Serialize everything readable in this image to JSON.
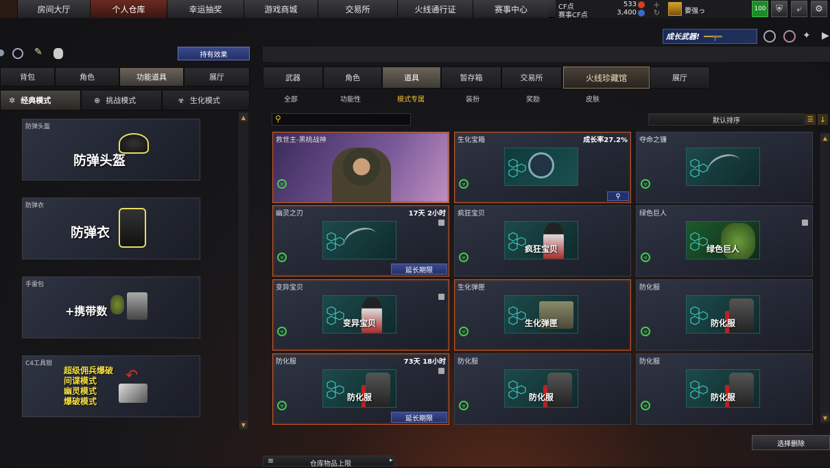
{
  "nav": {
    "tabs": [
      "房间大厅",
      "个人仓库",
      "幸运抽奖",
      "游戏商城",
      "交易所",
      "火线通行证",
      "赛事中心"
    ],
    "active_index": 1
  },
  "currency": {
    "cf_label": "CF点",
    "cf_value": "533",
    "match_cf_label": "赛事CF点",
    "match_cf_value": "3,400"
  },
  "user": {
    "name": "要强っ",
    "level": "100"
  },
  "promo": {
    "text": "成长武器!"
  },
  "left": {
    "effect_button": "持有效果",
    "tabs": [
      "背包",
      "角色",
      "功能道具",
      "展厅"
    ],
    "selected_tab": 2,
    "modes": [
      "经典模式",
      "挑战模式",
      "生化模式"
    ],
    "selected_mode": 0,
    "cards": [
      {
        "title": "防弹头盔",
        "big": "防弹头盔"
      },
      {
        "title": "防弹衣",
        "big": "防弹衣"
      },
      {
        "title": "手雷包",
        "big": "+携带数"
      },
      {
        "title": "C4工具钳",
        "lines": [
          "超级佣兵爆破",
          "间谍模式",
          "幽灵模式",
          "爆破模式"
        ]
      }
    ]
  },
  "right": {
    "tabs": [
      "武器",
      "角色",
      "道具",
      "暂存箱",
      "交易所",
      "火线珍藏馆",
      "展厅"
    ],
    "selected_tab": 2,
    "subtabs": [
      "全部",
      "功能性",
      "模式专属",
      "装扮",
      "奖励",
      "皮肤"
    ],
    "selected_subtab": 2,
    "search_placeholder": "",
    "sort_label": "默认排序",
    "items": [
      {
        "name": "救世主-黑桃战神",
        "extra": "",
        "thumb": "",
        "theme": "portrait"
      },
      {
        "name": "生化宝箱",
        "extra": "成长率27.2%",
        "thumb": "",
        "theme": "chest"
      },
      {
        "name": "夺命之镰",
        "extra": "",
        "thumb": "",
        "theme": "scythe"
      },
      {
        "name": "幽灵之刃",
        "extra": "17天 2小时",
        "thumb": "",
        "theme": "scythe",
        "extend": "延长期限"
      },
      {
        "name": "疯狂宝贝",
        "extra": "",
        "thumb": "疯狂宝贝",
        "theme": "char"
      },
      {
        "name": "绿色巨人",
        "extra": "",
        "thumb": "绿色巨人",
        "theme": "green"
      },
      {
        "name": "变异宝贝",
        "extra": "",
        "thumb": "变异宝贝",
        "theme": "char"
      },
      {
        "name": "生化弹匣",
        "extra": "",
        "thumb": "生化弹匣",
        "theme": "ammo"
      },
      {
        "name": "防化服",
        "extra": "",
        "thumb": "防化服",
        "theme": "suit"
      },
      {
        "name": "防化服",
        "extra": "73天 18小时",
        "thumb": "防化服",
        "theme": "suit",
        "extend": "延长期限"
      },
      {
        "name": "防化服",
        "extra": "",
        "thumb": "防化服",
        "theme": "suit"
      },
      {
        "name": "防化服",
        "extra": "",
        "thumb": "防化服",
        "theme": "suit"
      }
    ],
    "delete_button": "选择删除",
    "footer_label": "仓库物品上限"
  },
  "colors": {
    "accent": "#c25a2a",
    "gold": "#f0c030",
    "green": "#3fd04a",
    "extend_blue": "#2d3a7a"
  }
}
